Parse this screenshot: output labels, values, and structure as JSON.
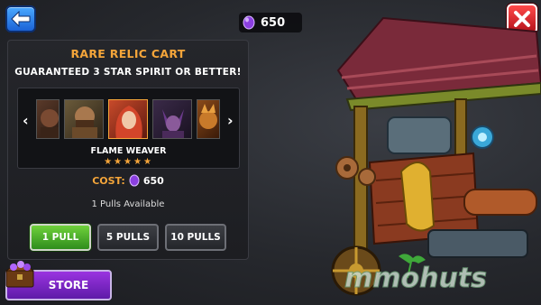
{
  "top_bar": {
    "back_icon": "left-arrow-icon",
    "close_icon": "close-x-icon",
    "gem_count": "650",
    "gem_icon": "purple-gem-icon"
  },
  "cart_panel": {
    "title": "RARE RELIC CART",
    "subtitle": "GUARANTEED 3 STAR SPIRIT OR BETTER!",
    "spirit_name": "FLAME WEAVER",
    "stars": "★★★★★",
    "star_count": 5,
    "cost_label": "COST:",
    "cost_value": "650",
    "pulls_available": "1 Pulls Available",
    "pull_buttons": [
      "1 PULL",
      "5 PULLS",
      "10 PULLS"
    ],
    "selected_pull": "1 PULL"
  },
  "store": {
    "label": "STORE"
  },
  "colors": {
    "accent_orange": "#f4a53a",
    "gem_purple": "#8b3fe0",
    "active_green": "#4fb52a",
    "store_purple": "#7b26c8"
  }
}
